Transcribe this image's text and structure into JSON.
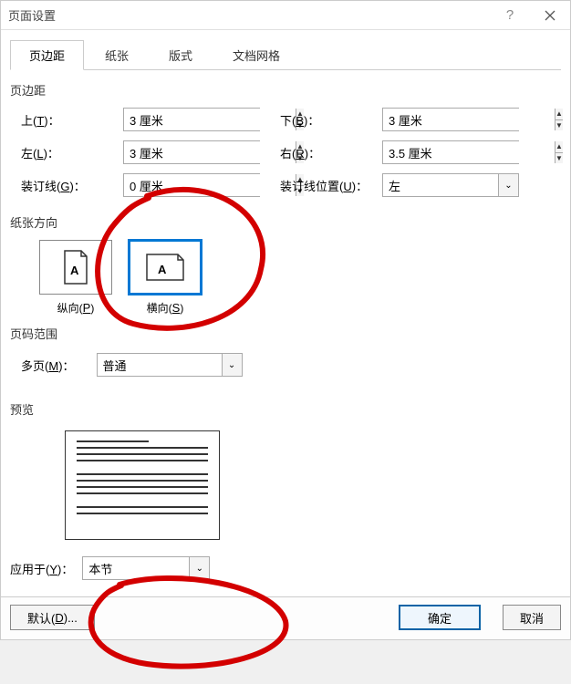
{
  "title": "页面设置",
  "tabs": {
    "margins": "页边距",
    "paper": "纸张",
    "layout": "版式",
    "grid": "文档网格"
  },
  "sections": {
    "margins": "页边距",
    "orientation": "纸张方向",
    "pagerange": "页码范围",
    "preview": "预览"
  },
  "marginFields": {
    "topLabel": "上(T)：",
    "topValue": "3 厘米",
    "bottomLabel": "下(B)：",
    "bottomValue": "3 厘米",
    "leftLabel": "左(L)：",
    "leftValue": "3 厘米",
    "rightLabel": "右(R)：",
    "rightValue": "3.5 厘米",
    "gutterLabel": "装订线(G)：",
    "gutterValue": "0 厘米",
    "gutterPosLabel": "装订线位置(U)：",
    "gutterPosValue": "左"
  },
  "orientation": {
    "portraitLabel": "纵向(P)",
    "landscapeLabel": "横向(S)"
  },
  "multipage": {
    "label": "多页(M)：",
    "value": "普通"
  },
  "applyTo": {
    "label": "应用于(Y)：",
    "value": "本节"
  },
  "buttons": {
    "default": "默认(D)...",
    "ok": "确定",
    "cancel": "取消"
  }
}
